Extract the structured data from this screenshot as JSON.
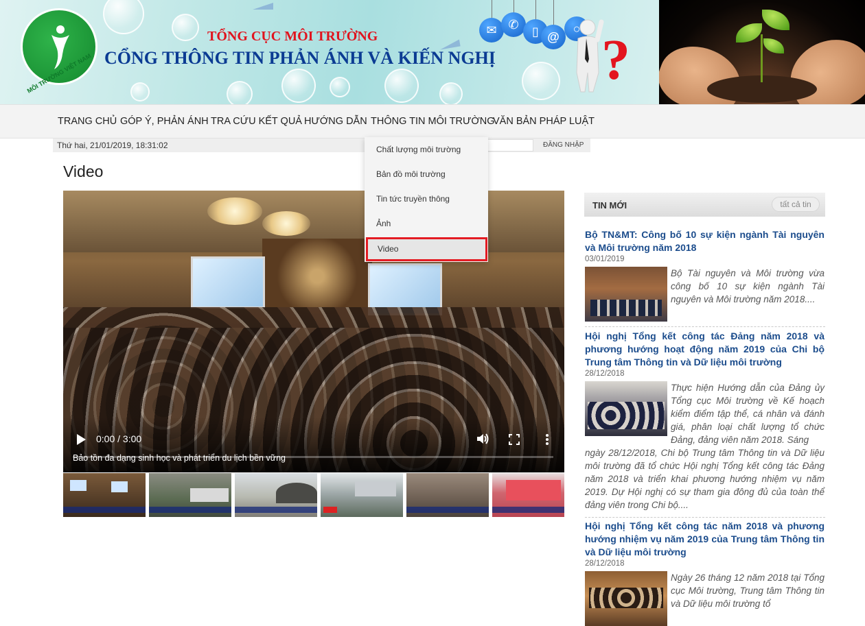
{
  "header": {
    "logo_text": "MÔI TRƯỜNG VIỆT NAM",
    "org_name": "TỔNG CỤC MÔI TRƯỜNG",
    "portal_name": "CỔNG THÔNG TIN PHẢN ÁNH VÀ KIẾN NGHỊ"
  },
  "nav": {
    "items": [
      {
        "label": "TRANG CHỦ"
      },
      {
        "label": "GÓP Ý, PHẢN ÁNH"
      },
      {
        "label": "TRA CỨU KẾT QUẢ"
      },
      {
        "label": "HƯỚNG DẪN"
      },
      {
        "label": "THÔNG TIN MÔI TRƯỜNG"
      },
      {
        "label": "VĂN BẢN PHÁP LUẬT"
      }
    ]
  },
  "datebar": {
    "date": "Thứ hai, 21/01/2019, 18:31:02",
    "login_label": "ĐĂNG NHẬP"
  },
  "dropdown": {
    "items": [
      {
        "label": "Chất lượng môi trường"
      },
      {
        "label": "Bản đồ môi trường"
      },
      {
        "label": "Tin tức truyền thông"
      },
      {
        "label": "Ảnh"
      },
      {
        "label": "Video"
      }
    ],
    "active_index": 4,
    "highlight_color": "#e41b23"
  },
  "page": {
    "title": "Video"
  },
  "video": {
    "time": "0:00 / 3:00",
    "caption": "Bảo tồn đa dạng sinh học và phát triển du lịch bền vững",
    "progress": 0
  },
  "sidebar": {
    "title": "TIN MỚI",
    "all_label": "tất cả tin",
    "news": [
      {
        "title": "Bộ TN&MT: Công bố 10 sự kiện ngành Tài nguyên và Môi trường năm 2018",
        "date": "03/01/2019",
        "desc": "Bộ Tài nguyên và Môi trường vừa công bố 10 sự kiện ngành Tài nguyên và Môi trường năm 2018...."
      },
      {
        "title": "Hội nghị Tổng kết công tác Đảng năm 2018 và phương hướng hoạt động năm 2019 của Chi bộ Trung tâm Thông tin và Dữ liệu môi trường",
        "date": "28/12/2018",
        "desc_side": "Thực hiện Hướng dẫn của Đảng ủy Tổng cục Môi trường về Kế hoạch kiểm điểm tập thể, cá nhân và đánh giá, phân loại chất lượng tổ chức Đảng, đảng viên năm 2018. Sáng",
        "desc_wide": "ngày 28/12/2018, Chi bộ Trung tâm Thông tin và Dữ liệu môi trường đã tổ chức Hội nghị Tổng kết công tác Đảng năm 2018 và triển khai phương hướng nhiệm vụ năm 2019. Dự Hội nghị có sự tham gia đông đủ của toàn thể đảng viên trong Chi bộ...."
      },
      {
        "title": "Hội nghị Tổng kết công tác năm 2018 và phương hướng nhiệm vụ năm 2019 của Trung tâm Thông tin và Dữ liệu môi trường",
        "date": "28/12/2018",
        "desc": "Ngày 26 tháng 12 năm 2018 tại Tổng cục Môi trường, Trung tâm Thông tin và Dữ liệu môi trường tổ"
      }
    ]
  }
}
